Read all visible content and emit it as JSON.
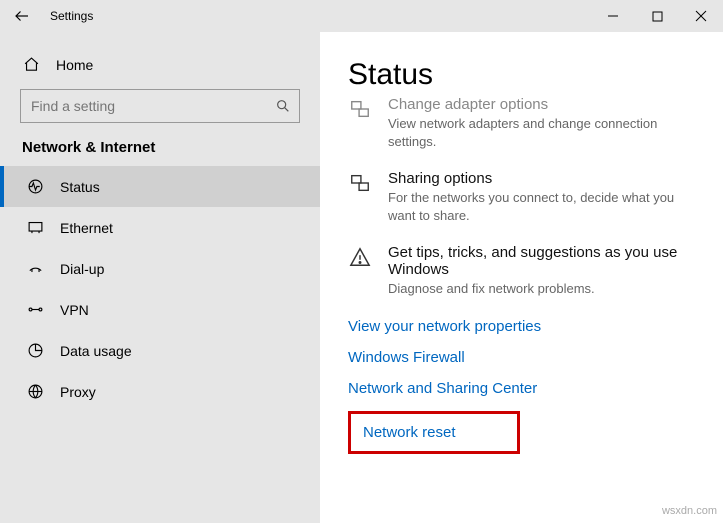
{
  "titlebar": {
    "title": "Settings"
  },
  "sidebar": {
    "home": "Home",
    "search_placeholder": "Find a setting",
    "section": "Network & Internet",
    "items": [
      {
        "label": "Status"
      },
      {
        "label": "Ethernet"
      },
      {
        "label": "Dial-up"
      },
      {
        "label": "VPN"
      },
      {
        "label": "Data usage"
      },
      {
        "label": "Proxy"
      }
    ]
  },
  "content": {
    "heading": "Status",
    "options": [
      {
        "title": "Change adapter options",
        "desc": "View network adapters and change connection settings."
      },
      {
        "title": "Sharing options",
        "desc": "For the networks you connect to, decide what you want to share."
      },
      {
        "title": "Get tips, tricks, and suggestions as you use Windows",
        "desc": "Diagnose and fix network problems."
      }
    ],
    "links": [
      "View your network properties",
      "Windows Firewall",
      "Network and Sharing Center",
      "Network reset"
    ]
  },
  "watermark": "wsxdn.com"
}
